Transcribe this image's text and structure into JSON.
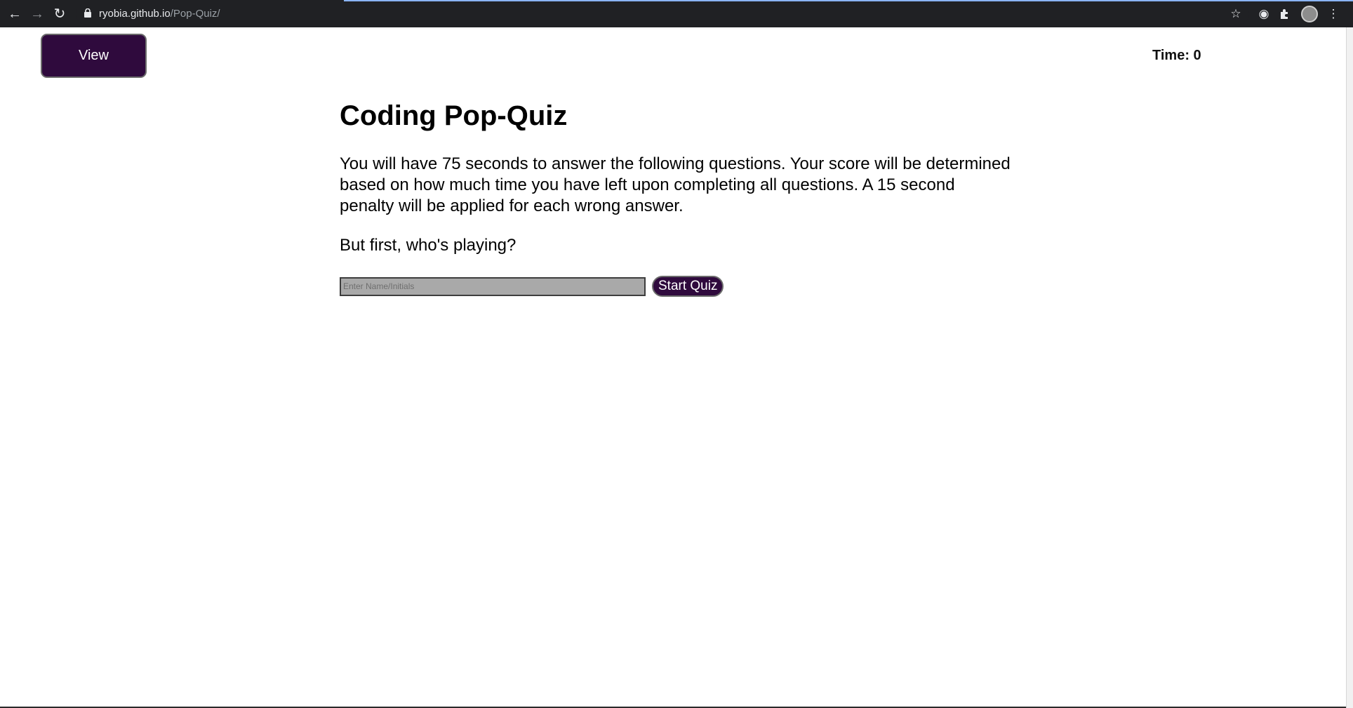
{
  "browser": {
    "url_host": "ryobia.github.io",
    "url_path": "/Pop-Quiz/"
  },
  "header": {
    "highscores_label": "View Highscores",
    "timer_text": "Time: 0"
  },
  "main": {
    "title": "Coding Pop-Quiz",
    "intro": "You will have 75 seconds to answer the following questions. Your score will be determined based on how much time you have left upon completing all questions. A 15 second penalty will be applied for each wrong answer.",
    "prompt": "But first, who's playing?",
    "name_placeholder": "Enter Name/Initials",
    "name_value": "",
    "start_label": "Start Quiz"
  },
  "colors": {
    "button_bg": "#2f0a3d",
    "input_bg": "#a9a9a9",
    "chrome_bg": "#202124"
  }
}
